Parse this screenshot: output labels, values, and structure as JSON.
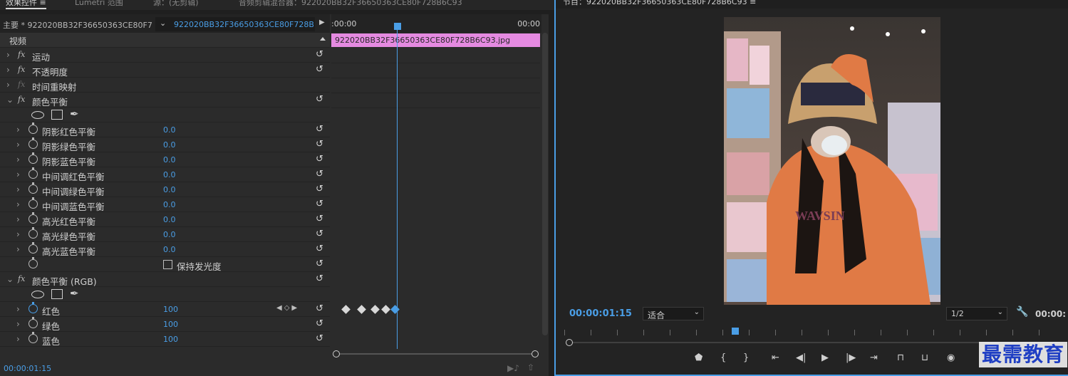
{
  "tabs": {
    "effect_controls": "效果控件 ≡",
    "lumetri_scopes": "Lumetri 范围",
    "source": "源：(无剪辑)",
    "audio_mixer": "音频剪辑混合器：922020BB32F36650363CE80F728B6C93"
  },
  "program_monitor": {
    "title": "节目：922020BB32F36650363CE80F728B6C93 ≡",
    "timecode": "00:00:01:15",
    "fit_label": "适合",
    "resolution": "1/2",
    "end_timecode": "00:00:"
  },
  "effect_controls": {
    "master_label": "主要 * 922020BB32F36650363CE80F7...",
    "sequence_clip": "922020BB32F36650363CE80F728B6...",
    "video_header": "视频",
    "motion": "运动",
    "opacity": "不透明度",
    "time_remap": "时间重映射",
    "color_balance": "颜色平衡",
    "shadow_red": "阴影红色平衡",
    "shadow_green": "阴影绿色平衡",
    "shadow_blue": "阴影蓝色平衡",
    "mid_red": "中间调红色平衡",
    "mid_green": "中间调绿色平衡",
    "mid_blue": "中间调蓝色平衡",
    "hi_red": "高光红色平衡",
    "hi_green": "高光绿色平衡",
    "hi_blue": "高光蓝色平衡",
    "zero": "0.0",
    "preserve_luminosity": "保持发光度",
    "color_balance_rgb": "颜色平衡 (RGB)",
    "red": "红色",
    "green": "绿色",
    "blue": "蓝色",
    "hundred": "100",
    "footer_timecode": "00:00:01:15"
  },
  "timeline": {
    "start": ":00:00",
    "end": "00:00",
    "clip_name": "922020BB32F36650363CE80F728B6C93.jpg"
  },
  "watermark": "最需教育",
  "colors": {
    "accent": "#4a9ee6",
    "clip": "#e58ae1",
    "panel": "#2b2b2b"
  }
}
